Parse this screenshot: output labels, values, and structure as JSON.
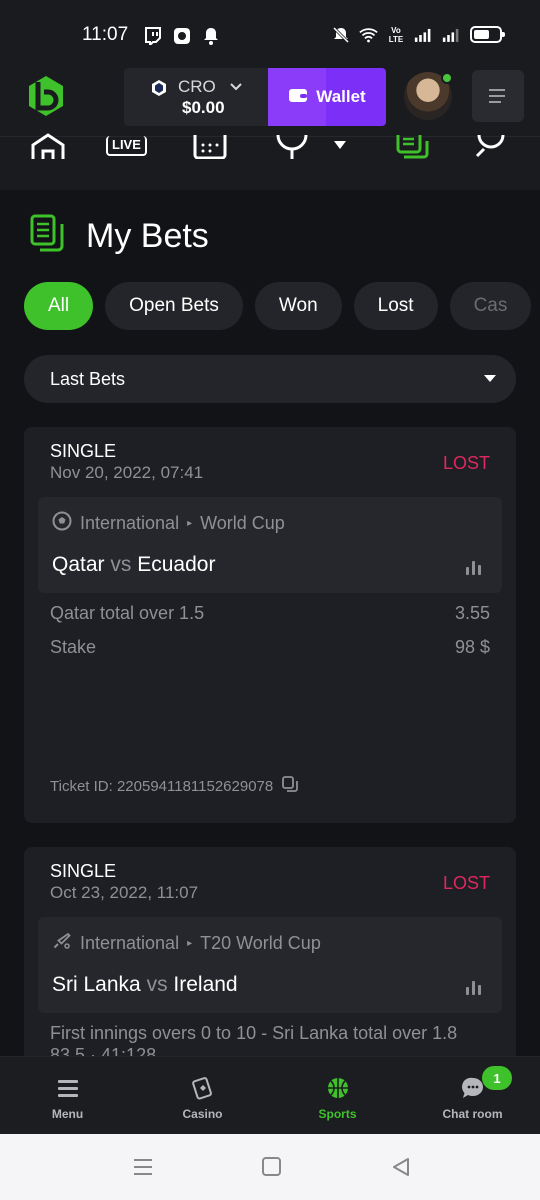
{
  "status_bar": {
    "time": "11:07",
    "left_icons": [
      "twitch-icon",
      "app-icon",
      "bell-icon"
    ],
    "right_icons": [
      "mute-icon",
      "wifi-icon",
      "volte-icon",
      "signal-icon",
      "signal-icon-2",
      "battery-icon"
    ],
    "volte_label": "Vo LTE"
  },
  "header": {
    "currency_code": "CRO",
    "balance": "$0.00",
    "wallet_label": "Wallet",
    "colors": {
      "accent": "#7b2ff7",
      "brand": "#3ec12a",
      "online": "#48c53b"
    }
  },
  "sport_nav": {
    "items": [
      {
        "name": "home-icon"
      },
      {
        "name": "live-icon",
        "label": "LIVE"
      },
      {
        "name": "calendar-icon"
      },
      {
        "name": "trophy-icon"
      },
      {
        "name": "bet-slip-icon",
        "active": true
      },
      {
        "name": "search-icon"
      }
    ]
  },
  "page": {
    "title": "My Bets",
    "filters": [
      "All",
      "Open Bets",
      "Won",
      "Lost",
      "Cas"
    ],
    "active_filter": "All",
    "dropdown_value": "Last Bets"
  },
  "bets": [
    {
      "type": "SINGLE",
      "date": "Nov 20, 2022, 07:41",
      "status": "LOST",
      "sport_icon": "soccer-ball-icon",
      "region": "International",
      "league": "World Cup",
      "home": "Qatar",
      "vs": "vs",
      "away": "Ecuador",
      "selection": "Qatar total over 1.5",
      "odds": "3.55",
      "stake_label": "Stake",
      "stake": "98 $",
      "ticket": "Ticket ID: 2205941181152629078"
    },
    {
      "type": "SINGLE",
      "date": "Oct 23, 2022, 11:07",
      "status": "LOST",
      "sport_icon": "cricket-bat-icon",
      "region": "International",
      "league": "T20 World Cup",
      "home": "Sri Lanka",
      "vs": "vs",
      "away": "Ireland",
      "selection": "First innings overs 0 to 10 - Sri Lanka total over 1.8",
      "partial_line": "83.5 · 41:128"
    }
  ],
  "tab_bar": {
    "tabs": [
      {
        "label": "Menu",
        "icon": "menu-icon"
      },
      {
        "label": "Casino",
        "icon": "casino-icon"
      },
      {
        "label": "Sports",
        "icon": "basketball-icon",
        "active": true
      },
      {
        "label": "Chat room",
        "icon": "chat-icon"
      }
    ],
    "chat_badge": "1"
  },
  "system_nav": [
    "recents-button",
    "home-button",
    "back-button"
  ]
}
